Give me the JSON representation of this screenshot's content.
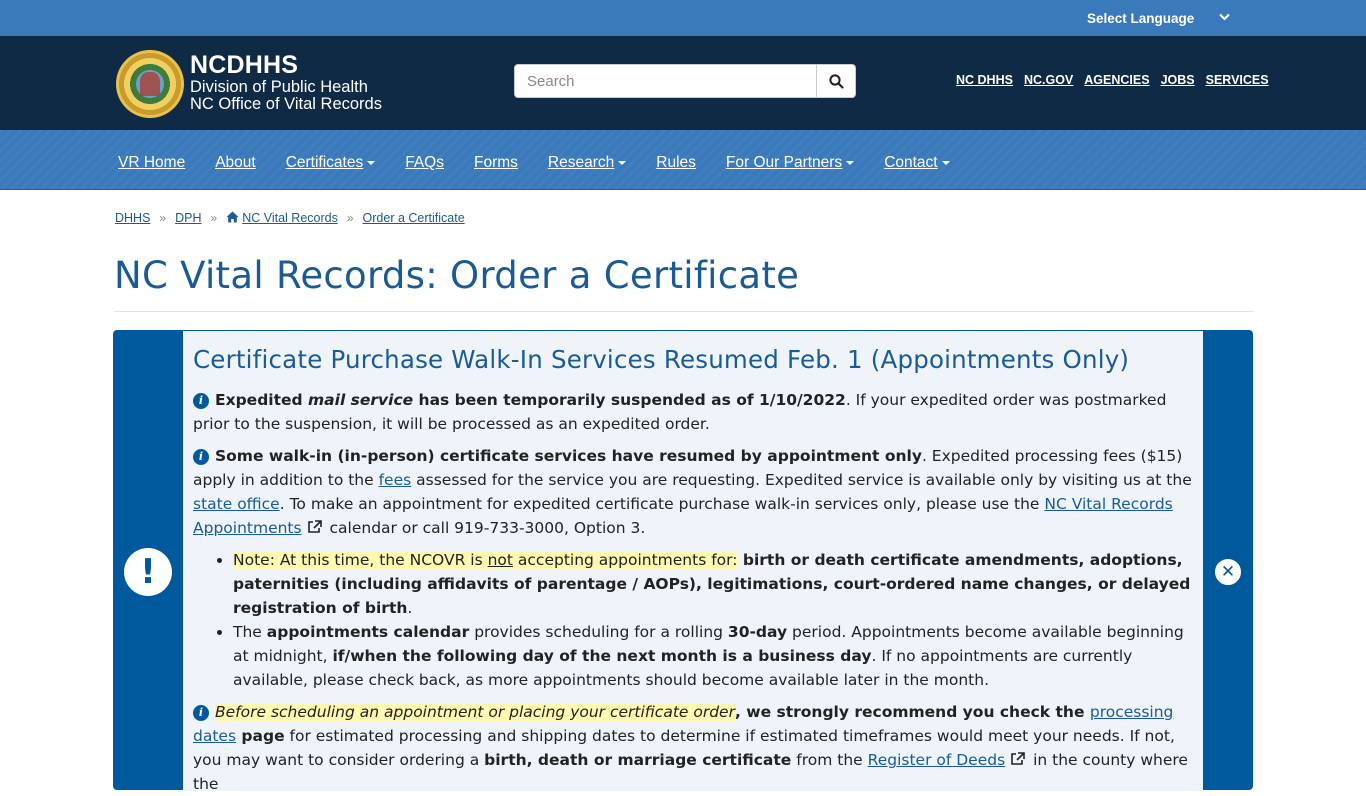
{
  "lang_bar": {
    "label": "Select Language",
    "chevron": "chevron-down-icon"
  },
  "header": {
    "seal_icon": "state-seal-icon",
    "brand_line1": "NCDHHS",
    "brand_line2": "Division of Public Health",
    "brand_line3": "NC Office of Vital Records",
    "search_placeholder": "Search",
    "search_icon": "search-icon",
    "util_links": [
      "NC DHHS",
      "NC.GOV",
      "AGENCIES",
      "JOBS",
      "SERVICES"
    ]
  },
  "nav": {
    "items": [
      {
        "label": "VR Home",
        "dropdown": false
      },
      {
        "label": "About",
        "dropdown": false
      },
      {
        "label": "Certificates",
        "dropdown": true
      },
      {
        "label": "FAQs",
        "dropdown": false
      },
      {
        "label": "Forms",
        "dropdown": false
      },
      {
        "label": "Research",
        "dropdown": true
      },
      {
        "label": "Rules",
        "dropdown": false
      },
      {
        "label": "For Our Partners",
        "dropdown": true
      },
      {
        "label": "Contact",
        "dropdown": true
      }
    ]
  },
  "breadcrumb": {
    "items": [
      "DHHS",
      "DPH",
      "NC Vital Records",
      "Order a Certificate"
    ],
    "separator": "»"
  },
  "page_title": "NC Vital Records: Order a Certificate",
  "alert": {
    "icon": "!",
    "close_icon": "✕",
    "heading": "Certificate Purchase Walk-In Services Resumed Feb. 1 (Appointments Only)",
    "p1": {
      "b1": "Expedited ",
      "i1": "mail service",
      "b2": " has been temporarily suspended as of 1/10/2022",
      "rest": ". If your expedited order was postmarked prior to the suspension, it will be processed as an expedited order."
    },
    "p2": {
      "b1": "Some walk-in (in-person) certificate services have resumed by appointment only",
      "t1": ". Expedited processing fees ($15) apply in addition to the ",
      "link_fees": "fees",
      "t2": " assessed for the service you are requesting. Expedited service is available only by visiting us at the ",
      "link_office": "state office",
      "t3": ". To make an appointment for expedited certificate purchase walk-in services only, please use the ",
      "link_appts": "NC Vital Records Appointments",
      "t4": " calendar or call 919-733-3000, Option 3."
    },
    "li1": {
      "h1": "Note: At this time, the NCOVR is ",
      "h_not": "not",
      "h2": " accepting appointments for:",
      "b1": " birth or death certificate amendments, adoptions, paternities (including affidavits of parentage / AOPs), legitimations, court-ordered name changes, or delayed registration of birth",
      "end": "."
    },
    "li2": {
      "t1": "The ",
      "b1": "appointments calendar",
      "t2": " provides scheduling for a rolling ",
      "b2": "30-day",
      "t3": " period. Appointments become available beginning at midnight, ",
      "b3": "if/when the following day of the next month is a business day",
      "t4": ". If no appointments are currently available, please check back, as more appointments should become available later in the month."
    },
    "p3": {
      "hi": "Before scheduling an appointment or placing your certificate order",
      "b1": ", we strongly recommend you check the ",
      "link_dates": "processing dates",
      "b2": " page",
      "t1": " for estimated processing and shipping dates to determine if estimated timeframes would meet your needs. If not, you may want to consider ordering a ",
      "b3": "birth, death or marriage certificate",
      "t2": " from the ",
      "link_rod": "Register of Deeds",
      "t3": " in the county where the"
    }
  },
  "colors": {
    "topbar": "#3a7abb",
    "header": "#0f2a44",
    "accent": "#1a5a96",
    "alert_band": "#00599c",
    "alert_bg": "#eef4fa",
    "highlight": "#fff8b0"
  }
}
